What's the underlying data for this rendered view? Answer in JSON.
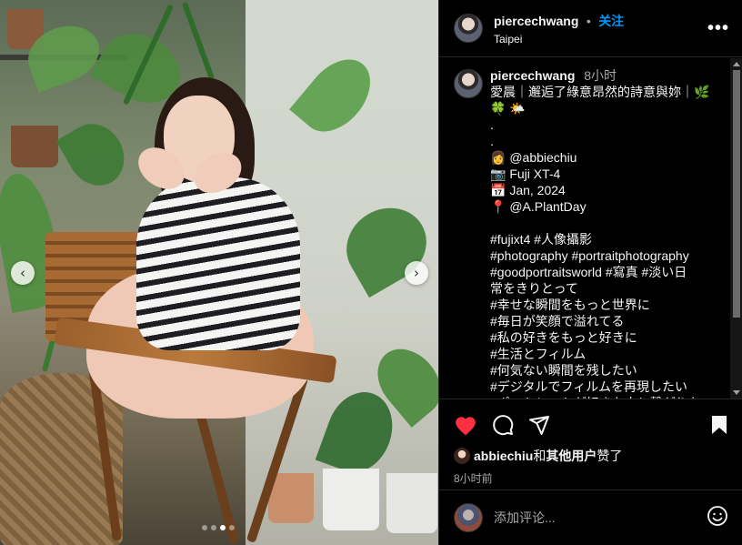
{
  "post": {
    "username": "piercechwang",
    "separator": "•",
    "follow_label": "关注",
    "location": "Taipei",
    "more_label": "•••"
  },
  "caption": {
    "username": "piercechwang",
    "time": "8小时",
    "lines": [
      "愛晨｜邂逅了綠意昂然的詩意與妳｜🌿",
      "🍀 🌤️",
      ".",
      ".",
      "👩 @abbiechiu",
      "📷 Fuji XT-4",
      "📅 Jan, 2024",
      "📍 @A.PlantDay",
      "",
      "#fujixt4 #人像攝影",
      "#photography #portraitphotography",
      "#goodportraitsworld #寫真 #淡い日",
      "常をきりとって",
      "#幸せな瞬間をもっと世界に",
      "#毎日が笑顔で溢れてる",
      "#私の好きをもっと好きに",
      "#生活とフィルム",
      "#何気ない瞬間を残したい",
      "#デジタルでフィルムを再現したい",
      "#ポートレートが好きな人と繋がりた"
    ]
  },
  "carousel": {
    "prev_label": "‹",
    "next_label": "›",
    "dots": 4,
    "active_index": 2
  },
  "likes": {
    "user": "abbiechiu",
    "connector": "和",
    "others": "其他用户",
    "suffix": "赞了"
  },
  "posted_time": "8小时前",
  "composer": {
    "placeholder": "添加评论..."
  },
  "colors": {
    "accent": "#0095f6",
    "like": "#ff3040",
    "background": "#000000"
  },
  "icons": {
    "like": "heart-filled-icon",
    "comment": "comment-bubble-icon",
    "share": "paper-plane-icon",
    "save": "bookmark-filled-icon",
    "emoji": "smiley-icon",
    "more": "more-horizontal-icon"
  }
}
